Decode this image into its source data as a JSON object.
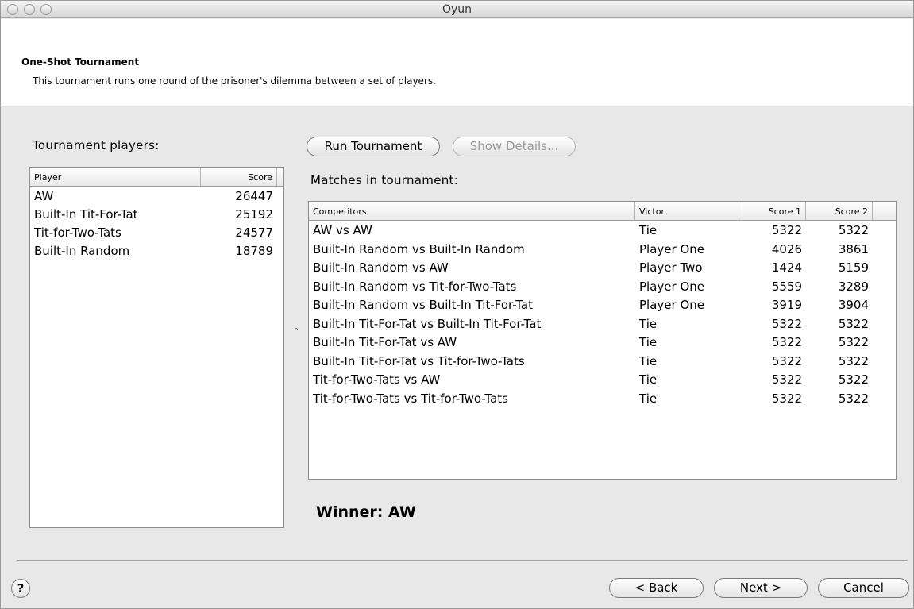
{
  "window": {
    "title": "Oyun"
  },
  "header": {
    "title": "One-Shot Tournament",
    "description": "This tournament runs one round of the prisoner's dilemma between a set of players."
  },
  "players": {
    "label": "Tournament players:",
    "columns": [
      "Player",
      "Score"
    ],
    "rows": [
      {
        "name": "AW",
        "score": "26447"
      },
      {
        "name": "Built-In Tit-For-Tat",
        "score": "25192"
      },
      {
        "name": "Tit-for-Two-Tats",
        "score": "24577"
      },
      {
        "name": "Built-In Random",
        "score": "18789"
      }
    ]
  },
  "actions": {
    "run_label": "Run Tournament",
    "details_label": "Show Details..."
  },
  "matches": {
    "label": "Matches in tournament:",
    "columns": [
      "Competitors",
      "Victor",
      "Score 1",
      "Score 2"
    ],
    "rows": [
      {
        "competitors": "AW vs AW",
        "victor": "Tie",
        "score1": "5322",
        "score2": "5322"
      },
      {
        "competitors": "Built-In Random vs Built-In Random",
        "victor": "Player One",
        "score1": "4026",
        "score2": "3861"
      },
      {
        "competitors": "Built-In Random vs AW",
        "victor": "Player Two",
        "score1": "1424",
        "score2": "5159"
      },
      {
        "competitors": "Built-In Random vs Tit-for-Two-Tats",
        "victor": "Player One",
        "score1": "5559",
        "score2": "3289"
      },
      {
        "competitors": "Built-In Random vs Built-In Tit-For-Tat",
        "victor": "Player One",
        "score1": "3919",
        "score2": "3904"
      },
      {
        "competitors": "Built-In Tit-For-Tat vs Built-In Tit-For-Tat",
        "victor": "Tie",
        "score1": "5322",
        "score2": "5322"
      },
      {
        "competitors": "Built-In Tit-For-Tat vs AW",
        "victor": "Tie",
        "score1": "5322",
        "score2": "5322"
      },
      {
        "competitors": "Built-In Tit-For-Tat vs Tit-for-Two-Tats",
        "victor": "Tie",
        "score1": "5322",
        "score2": "5322"
      },
      {
        "competitors": "Tit-for-Two-Tats vs AW",
        "victor": "Tie",
        "score1": "5322",
        "score2": "5322"
      },
      {
        "competitors": "Tit-for-Two-Tats vs Tit-for-Two-Tats",
        "victor": "Tie",
        "score1": "5322",
        "score2": "5322"
      }
    ]
  },
  "winner_text": "Winner: AW",
  "footer": {
    "help_label": "?",
    "back_label": "< Back",
    "next_label": "Next >",
    "cancel_label": "Cancel"
  }
}
